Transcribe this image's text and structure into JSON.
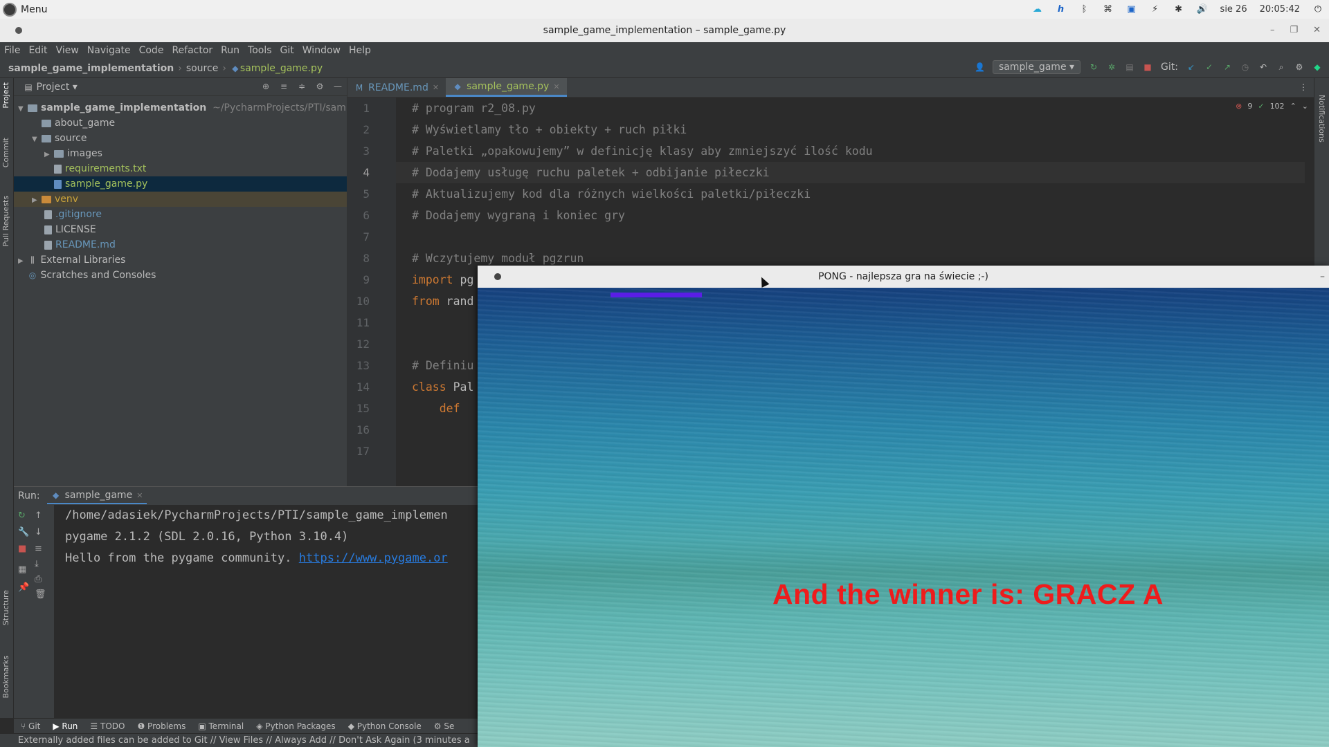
{
  "os": {
    "menu_label": "Menu",
    "date": "sie 26",
    "time": "20:05:42"
  },
  "window": {
    "title": "sample_game_implementation – sample_game.py"
  },
  "menubar": [
    "File",
    "Edit",
    "View",
    "Navigate",
    "Code",
    "Refactor",
    "Run",
    "Tools",
    "Git",
    "Window",
    "Help"
  ],
  "breadcrumb": {
    "project": "sample_game_implementation",
    "folder": "source",
    "file": "sample_game.py"
  },
  "toolbar": {
    "run_config": "sample_game",
    "git_label": "Git:"
  },
  "project_panel": {
    "title": "Project",
    "root_name": "sample_game_implementation",
    "root_path": "~/PycharmProjects/PTI/sample",
    "items": {
      "about_game": "about_game",
      "source": "source",
      "images": "images",
      "requirements": "requirements.txt",
      "sample_game": "sample_game.py",
      "venv": "venv",
      "gitignore": ".gitignore",
      "license": "LICENSE",
      "readme": "README.md",
      "ext_libs": "External Libraries",
      "scratches": "Scratches and Consoles"
    }
  },
  "left_strip": {
    "project": "Project",
    "commit": "Commit",
    "pull_requests": "Pull Requests",
    "structure": "Structure",
    "bookmarks": "Bookmarks"
  },
  "right_strip": {
    "notifications": "Notifications"
  },
  "editor": {
    "tabs": [
      "README.md",
      "sample_game.py"
    ],
    "inspection_errors": "9",
    "inspection_ok": "102",
    "line_numbers": [
      "1",
      "2",
      "3",
      "4",
      "5",
      "6",
      "7",
      "8",
      "9",
      "10",
      "11",
      "12",
      "13",
      "14",
      "15",
      "16",
      "17"
    ],
    "lines": {
      "l1": "# program r2_08.py",
      "l2": "# Wyświetlamy tło + obiekty + ruch piłki",
      "l3": "# Paletki „opakowujemy” w definicję klasy aby zmniejszyć ilość kodu",
      "l4": "# Dodajemy usługę ruchu paletek + odbijanie piłeczki",
      "l5": "# Aktualizujemy kod dla różnych wielkości paletki/piłeczki",
      "l6": "# Dodajemy wygraną i koniec gry",
      "l8": "# Wczytujemy moduł pgzrun",
      "l9_kw": "import",
      "l9_rest": " pg",
      "l10_kw": "from",
      "l10_rest": " rand",
      "l13": "# Definiu",
      "l14_kw": "class",
      "l14_rest": " Pal",
      "l15_kw": "def"
    }
  },
  "run_panel": {
    "label": "Run:",
    "tab": "sample_game",
    "output": {
      "line1": "/home/adasiek/PycharmProjects/PTI/sample_game_implemen",
      "line2": "pygame 2.1.2 (SDL 2.0.16, Python 3.10.4)",
      "line3_text": "Hello from the pygame community. ",
      "line3_link": "https://www.pygame.or"
    }
  },
  "bottom_tools": [
    "Git",
    "Run",
    "TODO",
    "Problems",
    "Terminal",
    "Python Packages",
    "Python Console",
    "Se"
  ],
  "status": "Externally added files can be added to Git // View Files // Always Add // Don't Ask Again (3 minutes a",
  "pong": {
    "title": "PONG - najlepsza gra na świecie ;-)",
    "winner_text": "And the winner is: GRACZ A",
    "paddle_color": "#5a1ee6",
    "winner_color": "#ee1c1c"
  }
}
